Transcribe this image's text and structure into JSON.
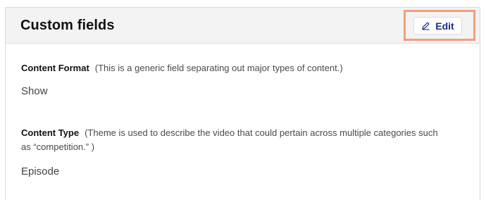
{
  "panel": {
    "title": "Custom fields",
    "edit_label": "Edit",
    "edit_icon": "pencil-icon",
    "highlight_color": "#f0a07a",
    "accent_color": "#1b2a8c"
  },
  "fields": [
    {
      "name": "Content Format",
      "description": "(This is a generic field separating out major types of content.)",
      "value": "Show"
    },
    {
      "name": "Content Type",
      "description": "(Theme is used to describe the video that could pertain across multiple categories such as “competition.” )",
      "value": "Episode"
    }
  ]
}
